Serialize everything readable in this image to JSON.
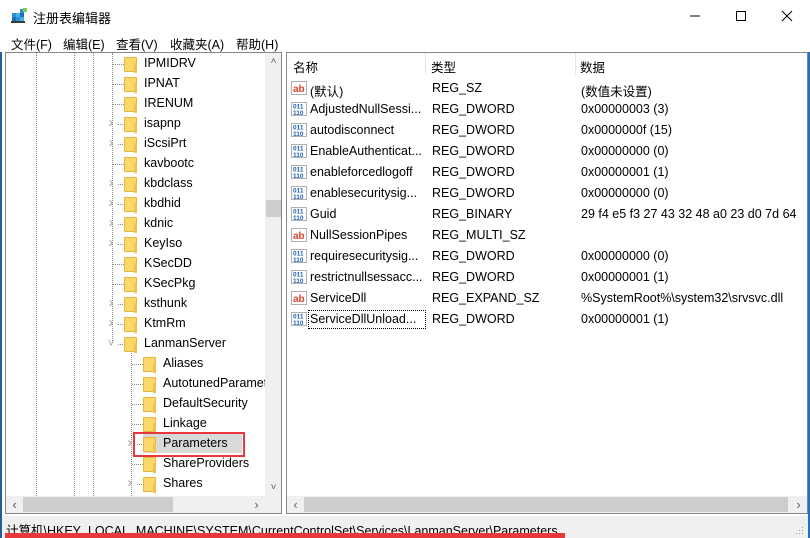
{
  "window": {
    "title": "注册表编辑器",
    "controls": {
      "minimize": "minimize",
      "maximize": "maximize",
      "close": "close"
    }
  },
  "menu": [
    {
      "label": "文件(F)"
    },
    {
      "label": "编辑(E)"
    },
    {
      "label": "查看(V)"
    },
    {
      "label": "收藏夹(A)"
    },
    {
      "label": "帮助(H)"
    }
  ],
  "tree": {
    "items": [
      {
        "label": "IPMIDRV",
        "expandable": false,
        "depth": 0
      },
      {
        "label": "IPNAT",
        "expandable": false,
        "depth": 0
      },
      {
        "label": "IRENUM",
        "expandable": false,
        "depth": 0
      },
      {
        "label": "isapnp",
        "expandable": true,
        "depth": 0
      },
      {
        "label": "iScsiPrt",
        "expandable": true,
        "depth": 0
      },
      {
        "label": "kavbootc",
        "expandable": false,
        "depth": 0
      },
      {
        "label": "kbdclass",
        "expandable": true,
        "depth": 0
      },
      {
        "label": "kbdhid",
        "expandable": true,
        "depth": 0
      },
      {
        "label": "kdnic",
        "expandable": true,
        "depth": 0
      },
      {
        "label": "KeyIso",
        "expandable": true,
        "depth": 0
      },
      {
        "label": "KSecDD",
        "expandable": false,
        "depth": 0
      },
      {
        "label": "KSecPkg",
        "expandable": false,
        "depth": 0
      },
      {
        "label": "ksthunk",
        "expandable": true,
        "depth": 0
      },
      {
        "label": "KtmRm",
        "expandable": true,
        "depth": 0
      },
      {
        "label": "LanmanServer",
        "expandable": true,
        "expanded": true,
        "depth": 0
      },
      {
        "label": "Aliases",
        "expandable": false,
        "depth": 1
      },
      {
        "label": "AutotunedParameters",
        "expandable": false,
        "depth": 1
      },
      {
        "label": "DefaultSecurity",
        "expandable": false,
        "depth": 1
      },
      {
        "label": "Linkage",
        "expandable": false,
        "depth": 1
      },
      {
        "label": "Parameters",
        "expandable": true,
        "depth": 1,
        "selected": true
      },
      {
        "label": "ShareProviders",
        "expandable": false,
        "depth": 1
      },
      {
        "label": "Shares",
        "expandable": true,
        "depth": 1
      }
    ]
  },
  "list": {
    "columns": {
      "name": "名称",
      "type": "类型",
      "data": "数据"
    },
    "rows": [
      {
        "icon": "string-value-icon",
        "name": "(默认)",
        "type": "REG_SZ",
        "data": "(数值未设置)"
      },
      {
        "icon": "binary-value-icon",
        "name": "AdjustedNullSessi...",
        "type": "REG_DWORD",
        "data": "0x00000003 (3)"
      },
      {
        "icon": "binary-value-icon",
        "name": "autodisconnect",
        "type": "REG_DWORD",
        "data": "0x0000000f (15)"
      },
      {
        "icon": "binary-value-icon",
        "name": "EnableAuthenticat...",
        "type": "REG_DWORD",
        "data": "0x00000000 (0)"
      },
      {
        "icon": "binary-value-icon",
        "name": "enableforcedlogoff",
        "type": "REG_DWORD",
        "data": "0x00000001 (1)"
      },
      {
        "icon": "binary-value-icon",
        "name": "enablesecuritysig...",
        "type": "REG_DWORD",
        "data": "0x00000000 (0)"
      },
      {
        "icon": "binary-value-icon",
        "name": "Guid",
        "type": "REG_BINARY",
        "data": "29 f4 e5 f3 27 43 32 48 a0 23 d0 7d 64"
      },
      {
        "icon": "string-value-icon",
        "name": "NullSessionPipes",
        "type": "REG_MULTI_SZ",
        "data": ""
      },
      {
        "icon": "binary-value-icon",
        "name": "requiresecuritysig...",
        "type": "REG_DWORD",
        "data": "0x00000000 (0)"
      },
      {
        "icon": "binary-value-icon",
        "name": "restrictnullsessacc...",
        "type": "REG_DWORD",
        "data": "0x00000001 (1)"
      },
      {
        "icon": "string-value-icon",
        "name": "ServiceDll",
        "type": "REG_EXPAND_SZ",
        "data": "%SystemRoot%\\system32\\srvsvc.dll"
      },
      {
        "icon": "binary-value-icon",
        "name": "ServiceDllUnload...",
        "type": "REG_DWORD",
        "data": "0x00000001 (1)",
        "focused": true
      }
    ]
  },
  "status": {
    "path": "计算机\\HKEY_LOCAL_MACHINE\\SYSTEM\\CurrentControlSet\\Services\\LanmanServer\\Parameters"
  },
  "colors": {
    "highlight_red": "#e8383d",
    "folder_yellow": "#fcd76a",
    "selection_gray": "#d9d9d9"
  }
}
